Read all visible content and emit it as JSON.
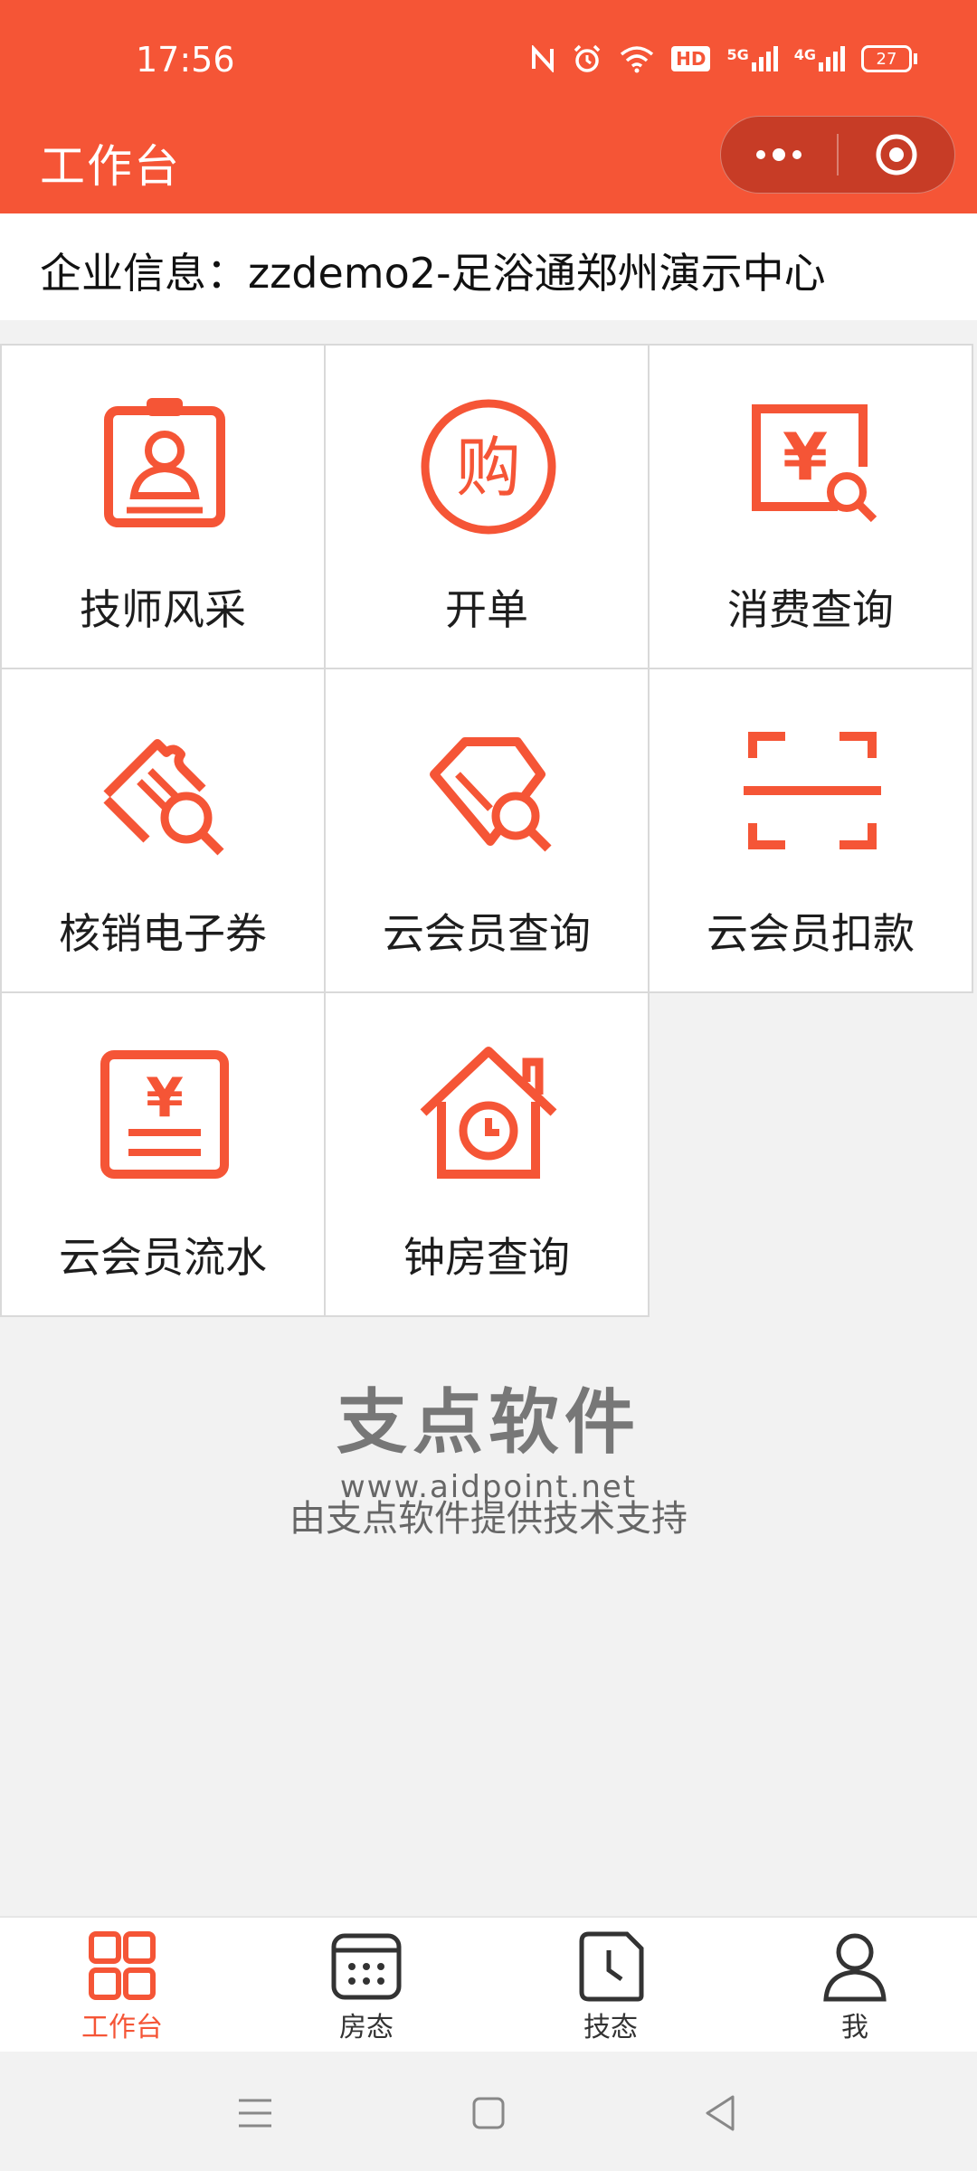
{
  "status": {
    "time": "17:56",
    "battery": "27",
    "net1": "5G",
    "net2": "4G",
    "hd": "HD"
  },
  "header": {
    "title": "工作台"
  },
  "enterprise": {
    "text": "企业信息：zzdemo2-足浴通郑州演示中心"
  },
  "grid": [
    {
      "label": "技师风采",
      "icon": "badge-icon"
    },
    {
      "label": "开单",
      "icon": "shopping-icon"
    },
    {
      "label": "消费查询",
      "icon": "receipt-search-icon"
    },
    {
      "label": "核销电子券",
      "icon": "coupon-search-icon"
    },
    {
      "label": "云会员查询",
      "icon": "diamond-search-icon"
    },
    {
      "label": "云会员扣款",
      "icon": "scan-icon"
    },
    {
      "label": "云会员流水",
      "icon": "yen-ledger-icon"
    },
    {
      "label": "钟房查询",
      "icon": "house-clock-icon"
    }
  ],
  "footer": {
    "brand": "支点软件",
    "url": "www.aidpoint.net",
    "support": "由支点软件提供技术支持"
  },
  "tabs": [
    {
      "label": "工作台",
      "active": true
    },
    {
      "label": "房态",
      "active": false
    },
    {
      "label": "技态",
      "active": false
    },
    {
      "label": "我",
      "active": false
    }
  ],
  "colors": {
    "accent": "#f55536"
  }
}
